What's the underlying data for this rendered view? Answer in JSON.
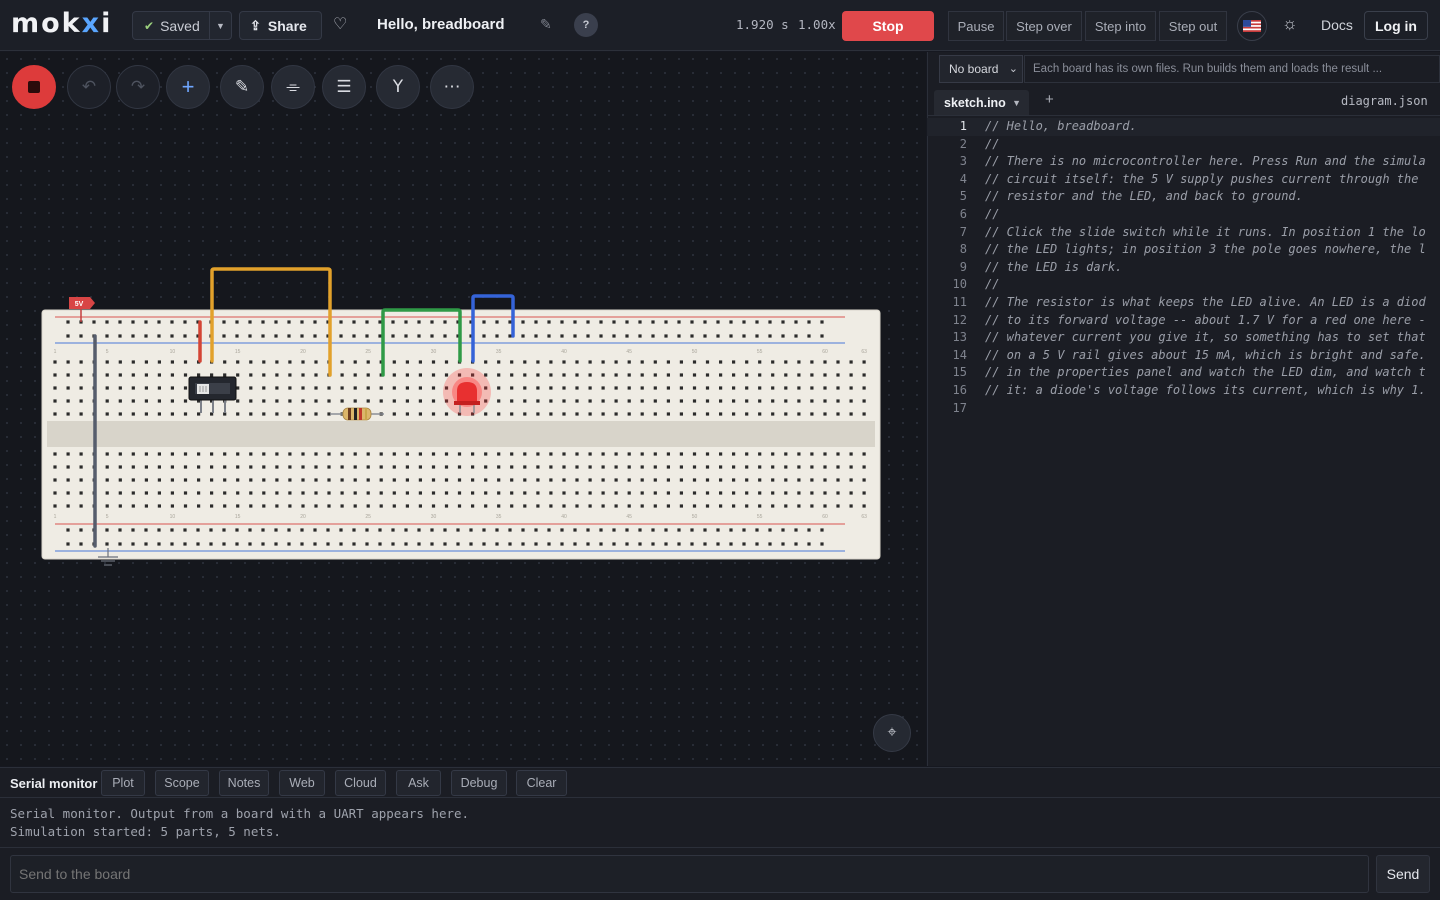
{
  "app": {
    "logo_prefix": "mok",
    "logo_x": "x",
    "logo_suffix": "i"
  },
  "header": {
    "saved_label": "Saved",
    "share_label": "Share",
    "project_title": "Hello, breadboard",
    "help_label": "?",
    "sim_time": "1.920 s",
    "sim_speed": "1.00x",
    "stop_label": "Stop",
    "pause_label": "Pause",
    "step_over_label": "Step over",
    "step_into_label": "Step into",
    "step_out_label": "Step out",
    "docs_label": "Docs",
    "login_label": "Log in"
  },
  "toolbar": {
    "icons": [
      "stop-record-icon",
      "undo-icon",
      "redo-icon",
      "add-icon",
      "pencil-icon",
      "align-icon",
      "layers-icon",
      "probe-icon",
      "more-icon"
    ]
  },
  "circuit": {
    "supply_label": "5V",
    "colors": {
      "wire_orange": "#e2a12b",
      "wire_green": "#2f9a46",
      "wire_blue": "#3563d8",
      "wire_red": "#d44535",
      "led": "#ff3b3b",
      "rail_red": "#d9534f",
      "rail_blue": "#4a78d9"
    },
    "column_numbers": [
      "1",
      "5",
      "10",
      "15",
      "20",
      "25",
      "30",
      "35",
      "40",
      "45",
      "50",
      "55",
      "60",
      "63"
    ]
  },
  "editor": {
    "board_select": "No board",
    "board_hint": "Each board has its own files. Run builds them and loads the result ...",
    "tab_active": "sketch.ino",
    "tab_add": "+",
    "tab_other": "diagram.json",
    "lines": [
      {
        "n": "1",
        "t": "// Hello, breadboard."
      },
      {
        "n": "2",
        "t": "//"
      },
      {
        "n": "3",
        "t": "// There is no microcontroller here. Press Run and the simula"
      },
      {
        "n": "4",
        "t": "// circuit itself: the 5 V supply pushes current through the"
      },
      {
        "n": "5",
        "t": "// resistor and the LED, and back to ground."
      },
      {
        "n": "6",
        "t": "//"
      },
      {
        "n": "7",
        "t": "// Click the slide switch while it runs. In position 1 the lo"
      },
      {
        "n": "8",
        "t": "// the LED lights; in position 3 the pole goes nowhere, the l"
      },
      {
        "n": "9",
        "t": "// the LED is dark."
      },
      {
        "n": "10",
        "t": "//"
      },
      {
        "n": "11",
        "t": "// The resistor is what keeps the LED alive. An LED is a diod"
      },
      {
        "n": "12",
        "t": "// to its forward voltage -- about 1.7 V for a red one here -"
      },
      {
        "n": "13",
        "t": "// whatever current you give it, so something has to set that"
      },
      {
        "n": "14",
        "t": "// on a 5 V rail gives about 15 mA, which is bright and safe."
      },
      {
        "n": "15",
        "t": "// in the properties panel and watch the LED dim, and watch t"
      },
      {
        "n": "16",
        "t": "// it: a diode's voltage follows its current, which is why 1."
      },
      {
        "n": "17",
        "t": ""
      }
    ]
  },
  "bottom": {
    "title": "Serial monitor",
    "tabs": [
      "Plot",
      "Scope",
      "Notes",
      "Web",
      "Cloud",
      "Ask",
      "Debug",
      "Clear"
    ],
    "serial_lines": [
      "Serial monitor. Output from a board with a UART appears here.",
      "Simulation started: 5 parts, 5 nets."
    ],
    "send_placeholder": "Send to the board",
    "send_label": "Send"
  }
}
